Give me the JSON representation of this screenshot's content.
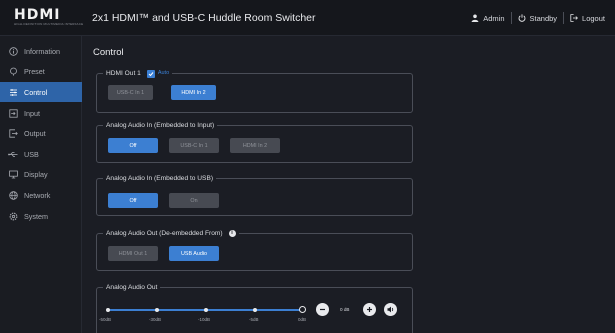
{
  "header": {
    "logo_text": "HDMI",
    "logo_subtext": "HIGH-DEFINITION MULTIMEDIA INTERFACE",
    "title": "2x1 HDMI™ and USB-C Huddle Room Switcher",
    "admin_label": "Admin",
    "standby_label": "Standby",
    "logout_label": "Logout"
  },
  "sidebar": {
    "items": [
      {
        "label": "Information",
        "icon": "info-icon",
        "active": false
      },
      {
        "label": "Preset",
        "icon": "preset-icon",
        "active": false
      },
      {
        "label": "Control",
        "icon": "control-icon",
        "active": true
      },
      {
        "label": "Input",
        "icon": "input-icon",
        "active": false
      },
      {
        "label": "Output",
        "icon": "output-icon",
        "active": false
      },
      {
        "label": "USB",
        "icon": "usb-icon",
        "active": false
      },
      {
        "label": "Display",
        "icon": "display-icon",
        "active": false
      },
      {
        "label": "Network",
        "icon": "network-icon",
        "active": false
      },
      {
        "label": "System",
        "icon": "system-icon",
        "active": false
      }
    ]
  },
  "main": {
    "title": "Control",
    "hdmi_out": {
      "label": "HDMI Out 1",
      "auto_label": "Auto",
      "auto_checked": true,
      "buttons": [
        {
          "label": "USB-C In 1",
          "selected": false
        },
        {
          "label": "HDMI In 2",
          "selected": true
        }
      ]
    },
    "audio_in_input": {
      "label": "Analog Audio In (Embedded to Input)",
      "buttons": [
        {
          "label": "Off",
          "selected": true
        },
        {
          "label": "USB-C In 1",
          "selected": false
        },
        {
          "label": "HDMI In 2",
          "selected": false
        }
      ]
    },
    "audio_in_usb": {
      "label": "Analog Audio In (Embedded to USB)",
      "buttons": [
        {
          "label": "Off",
          "selected": true
        },
        {
          "label": "On",
          "selected": false
        }
      ]
    },
    "audio_out_deembedded": {
      "label": "Analog Audio Out (De-embedded From)",
      "buttons": [
        {
          "label": "HDMI Out 1",
          "selected": false
        },
        {
          "label": "USB Audio",
          "selected": true
        }
      ]
    },
    "audio_out": {
      "label": "Analog Audio Out",
      "ticks": [
        "-50dB",
        "-30dB",
        "-10dB",
        "-5dB",
        "0dB"
      ],
      "value_display": "0 dB",
      "level_fraction": 1.0
    }
  },
  "colors": {
    "accent": "#3c7fd2",
    "background": "#1b1d24",
    "sidebar_active": "#2e64a8",
    "button_inactive": "#474a52"
  }
}
